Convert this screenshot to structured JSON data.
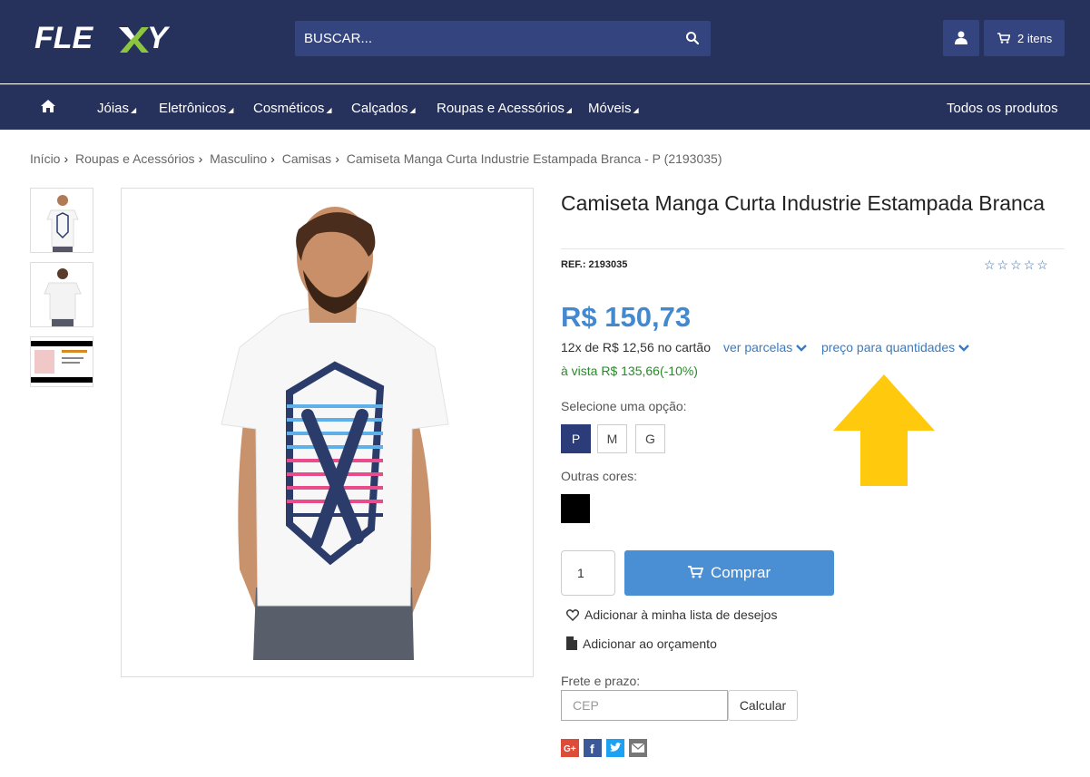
{
  "header": {
    "logo_text": "FLEXY",
    "search_placeholder": "BUSCAR...",
    "cart_label": "2 itens"
  },
  "nav": {
    "items": [
      {
        "label": "Jóias"
      },
      {
        "label": "Eletrônicos"
      },
      {
        "label": "Cosméticos"
      },
      {
        "label": "Calçados"
      },
      {
        "label": "Roupas e Acessórios"
      },
      {
        "label": "Móveis"
      }
    ],
    "all_products": "Todos os produtos"
  },
  "breadcrumb": [
    "Início",
    "Roupas e Acessórios",
    "Masculino",
    "Camisas",
    "Camiseta Manga Curta Industrie Estampada Branca - P (2193035)"
  ],
  "product": {
    "title": "Camiseta Manga Curta Industrie Estampada Branca",
    "ref": "REF.: 2193035",
    "rating_stars": 5,
    "price": "R$ 150,73",
    "installments": "12x de R$ 12,56 no cartão",
    "link_parcelas": "ver parcelas",
    "link_quantidades": "preço para quantidades",
    "cash_price": "à vista R$ 135,66(-10%)",
    "select_option_label": "Selecione uma opção:",
    "sizes": [
      "P",
      "M",
      "G"
    ],
    "selected_size": "P",
    "other_colors_label": "Outras cores:",
    "quantity": "1",
    "buy_label": "Comprar",
    "wishlist_label": "Adicionar à minha lista de desejos",
    "budget_label": "Adicionar ao orçamento",
    "shipping_label": "Frete e prazo:",
    "cep_placeholder": "CEP",
    "calc_label": "Calcular"
  },
  "colors": {
    "header_bg": "#26325b",
    "accent": "#4a8fd4",
    "price": "#4289cf",
    "arrow": "#ffc90e"
  }
}
